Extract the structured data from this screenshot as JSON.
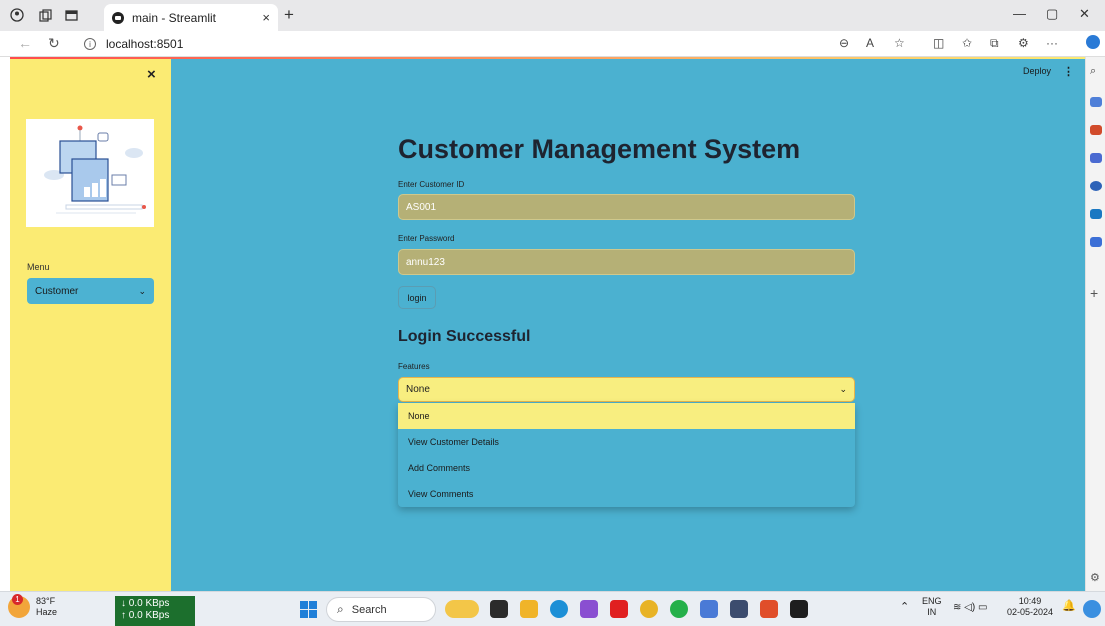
{
  "browser": {
    "tab_title": "main - Streamlit",
    "tab_close": "×",
    "new_tab": "+",
    "url": "localhost:8501",
    "window_controls": [
      "—",
      "▢",
      "✕"
    ]
  },
  "app": {
    "deploy_label": "Deploy",
    "menu_dots": "⋮",
    "title": "Customer Management System",
    "customer_id": {
      "label": "Enter Customer ID",
      "value": "AS001"
    },
    "password": {
      "label": "Enter Password",
      "value": "annu123"
    },
    "login_button": "login",
    "login_status": "Login Successful",
    "features": {
      "label": "Features",
      "selected": "None",
      "options": [
        "None",
        "View Customer Details",
        "Add Comments",
        "View Comments"
      ]
    }
  },
  "sidebar": {
    "close": "×",
    "menu_label": "Menu",
    "menu_selected": "Customer"
  },
  "taskbar": {
    "weather_temp": "83°F",
    "weather_desc": "Haze",
    "weather_badge": "1",
    "net_down": "↓ 0.0 KBps",
    "net_up": "↑ 0.0 KBps",
    "search_placeholder": "Search",
    "lang_top": "ENG",
    "lang_bottom": "IN",
    "time": "10:49",
    "date": "02-05-2024"
  },
  "colors": {
    "sidebar_bg": "#fbeb73",
    "main_bg": "#4bb1d0",
    "input_bg": "#b5b076",
    "select_bg": "#f8ee80"
  }
}
